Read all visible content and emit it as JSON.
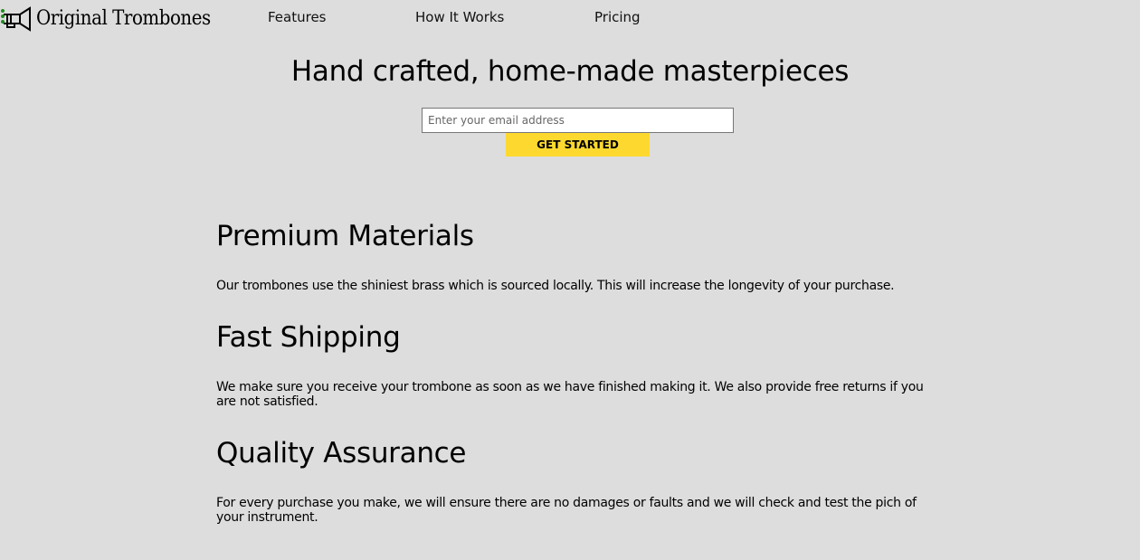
{
  "header": {
    "logo_text": "Original Trombones",
    "nav": [
      {
        "label": "Features"
      },
      {
        "label": "How It Works"
      },
      {
        "label": "Pricing"
      }
    ]
  },
  "hero": {
    "title": "Hand crafted, home-made masterpieces",
    "email_placeholder": "Enter your email address",
    "cta_label": "GET STARTED"
  },
  "features": [
    {
      "title": "Premium Materials",
      "text": "Our trombones use the shiniest brass which is sourced locally. This will increase the longevity of your purchase."
    },
    {
      "title": "Fast Shipping",
      "text": "We make sure you receive your trombone as soon as we have finished making it. We also provide free returns if you are not satisfied."
    },
    {
      "title": "Quality Assurance",
      "text": "For every purchase you make, we will ensure there are no damages or faults and we will check and test the pich of your instrument."
    }
  ],
  "colors": {
    "background": "#dddddd",
    "cta": "#fdd92f",
    "logo_accent": "#1e8f1e"
  },
  "icons": {
    "logo": "trombone-icon"
  }
}
